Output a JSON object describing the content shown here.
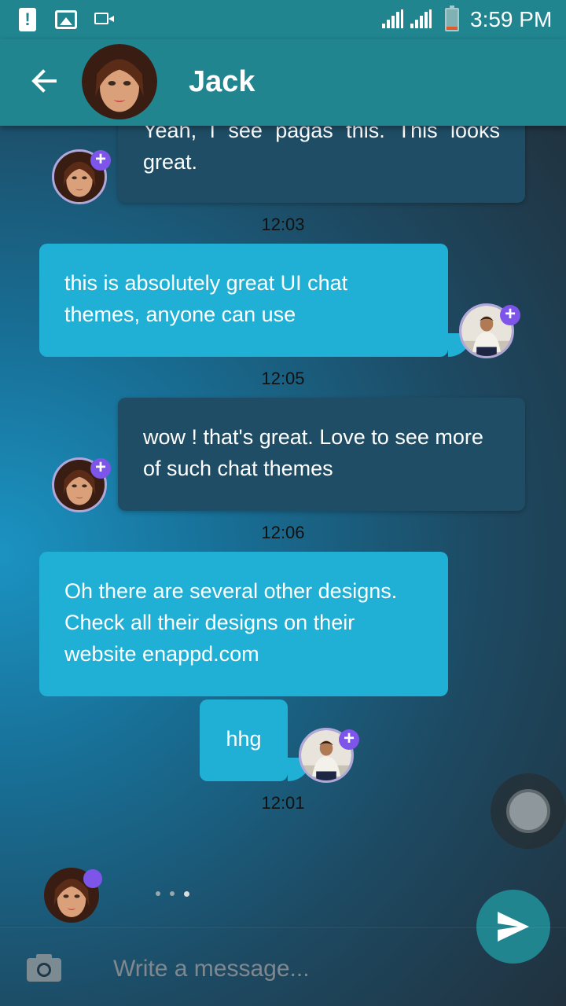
{
  "status_bar": {
    "time": "3:59 PM",
    "icons": [
      "alert-icon",
      "image-icon",
      "video-icon",
      "signal-icon",
      "signal-icon",
      "battery-icon"
    ]
  },
  "header": {
    "title": "Jack",
    "back_icon": "arrow-left-icon"
  },
  "messages": [
    {
      "side": "incoming",
      "text": "Yeah, I see pagas this. This looks great.",
      "time": "12:03"
    },
    {
      "side": "outgoing",
      "text": "this is absolutely great UI chat themes, anyone can use",
      "time": "12:05"
    },
    {
      "side": "incoming",
      "text": "wow ! that's great. Love to see more of such chat themes",
      "time": "12:06"
    },
    {
      "side": "outgoing",
      "text": "Oh there are several other designs. Check all their designs on their website enappd.com"
    },
    {
      "side": "outgoing",
      "text": "hhg",
      "time": "12:01"
    }
  ],
  "composer": {
    "placeholder": "Write a message...",
    "camera_icon": "camera-icon",
    "send_icon": "send-icon"
  },
  "colors": {
    "header": "#21858f",
    "outgoing_bubble": "#20b0d6",
    "incoming_bubble": "#1f4d66",
    "badge": "#7d55e8"
  }
}
